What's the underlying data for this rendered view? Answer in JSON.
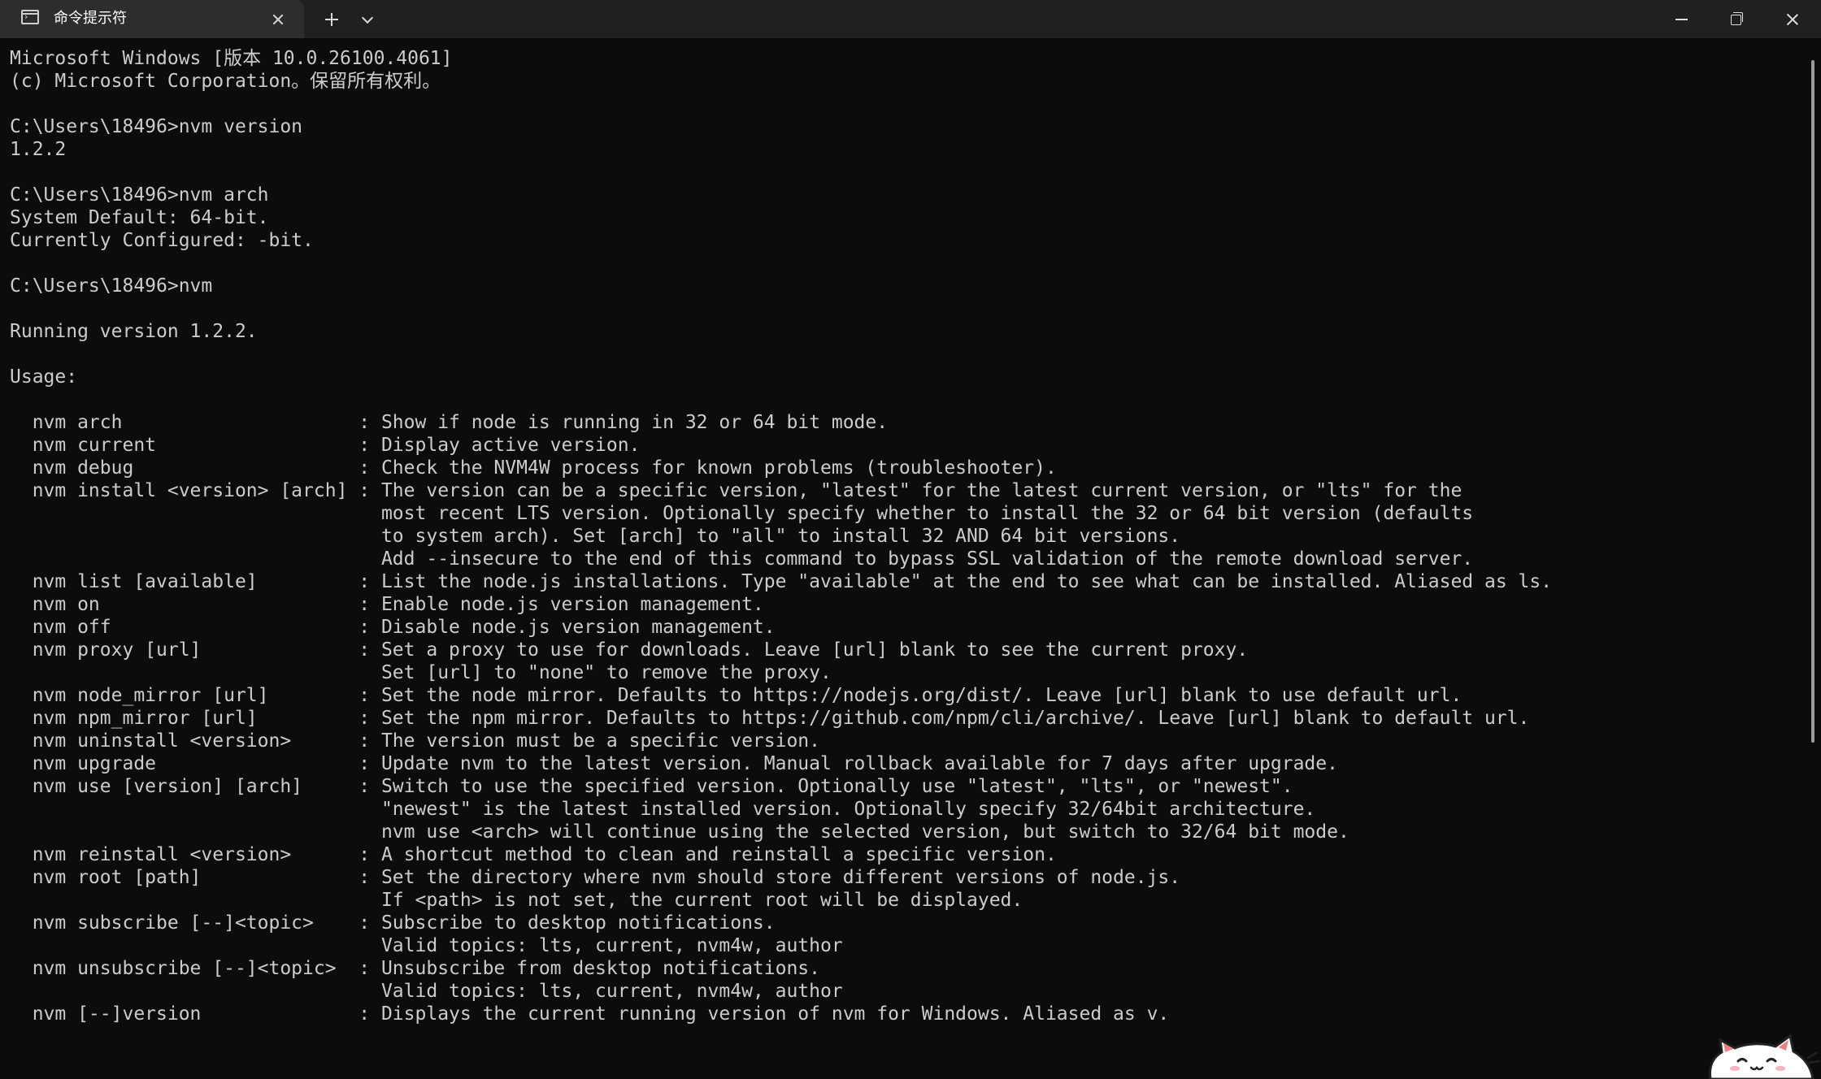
{
  "tab": {
    "title": "命令提示符",
    "icon": "terminal-icon",
    "close_icon": "close-icon"
  },
  "titlebar": {
    "new_tab_icon": "plus-icon",
    "dropdown_icon": "chevron-down-icon",
    "window_controls": [
      "minimize-icon",
      "restore-icon",
      "close-icon"
    ]
  },
  "colors": {
    "background": "#0c0c0c",
    "text": "#cccccc",
    "titlebar": "#202020",
    "active_tab": "#2d2d2d"
  },
  "terminal": {
    "lines": [
      "Microsoft Windows [版本 10.0.26100.4061]",
      "(c) Microsoft Corporation。保留所有权利。",
      "",
      "C:\\Users\\18496>nvm version",
      "1.2.2",
      "",
      "C:\\Users\\18496>nvm arch",
      "System Default: 64-bit.",
      "Currently Configured: -bit.",
      "",
      "C:\\Users\\18496>nvm",
      "",
      "Running version 1.2.2.",
      "",
      "Usage:",
      "",
      "  nvm arch                     : Show if node is running in 32 or 64 bit mode.",
      "  nvm current                  : Display active version.",
      "  nvm debug                    : Check the NVM4W process for known problems (troubleshooter).",
      "  nvm install <version> [arch] : The version can be a specific version, \"latest\" for the latest current version, or \"lts\" for the",
      "                                 most recent LTS version. Optionally specify whether to install the 32 or 64 bit version (defaults",
      "                                 to system arch). Set [arch] to \"all\" to install 32 AND 64 bit versions.",
      "                                 Add --insecure to the end of this command to bypass SSL validation of the remote download server.",
      "  nvm list [available]         : List the node.js installations. Type \"available\" at the end to see what can be installed. Aliased as ls.",
      "  nvm on                       : Enable node.js version management.",
      "  nvm off                      : Disable node.js version management.",
      "  nvm proxy [url]              : Set a proxy to use for downloads. Leave [url] blank to see the current proxy.",
      "                                 Set [url] to \"none\" to remove the proxy.",
      "  nvm node_mirror [url]        : Set the node mirror. Defaults to https://nodejs.org/dist/. Leave [url] blank to use default url.",
      "  nvm npm_mirror [url]         : Set the npm mirror. Defaults to https://github.com/npm/cli/archive/. Leave [url] blank to default url.",
      "  nvm uninstall <version>      : The version must be a specific version.",
      "  nvm upgrade                  : Update nvm to the latest version. Manual rollback available for 7 days after upgrade.",
      "  nvm use [version] [arch]     : Switch to use the specified version. Optionally use \"latest\", \"lts\", or \"newest\".",
      "                                 \"newest\" is the latest installed version. Optionally specify 32/64bit architecture.",
      "                                 nvm use <arch> will continue using the selected version, but switch to 32/64 bit mode.",
      "  nvm reinstall <version>      : A shortcut method to clean and reinstall a specific version.",
      "  nvm root [path]              : Set the directory where nvm should store different versions of node.js.",
      "                                 If <path> is not set, the current root will be displayed.",
      "  nvm subscribe [--]<topic>    : Subscribe to desktop notifications.",
      "                                 Valid topics: lts, current, nvm4w, author",
      "  nvm unsubscribe [--]<topic>  : Unsubscribe from desktop notifications.",
      "                                 Valid topics: lts, current, nvm4w, author",
      "  nvm [--]version              : Displays the current running version of nvm for Windows. Aliased as v."
    ]
  },
  "mascot": {
    "icon": "cat-mascot-icon"
  }
}
